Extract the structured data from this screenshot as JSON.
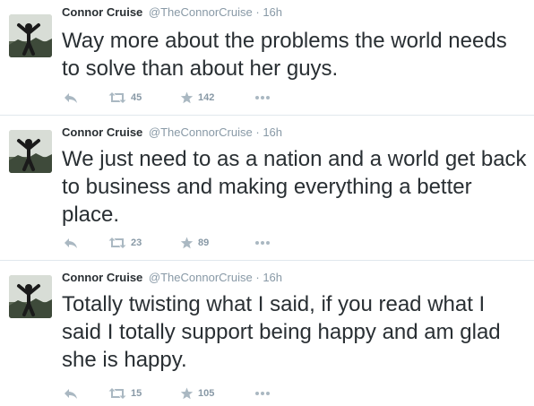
{
  "tweets": [
    {
      "name": "Connor Cruise",
      "handle": "@TheConnorCruise",
      "separator": "·",
      "time": "16h",
      "text": "Way more about the problems the world needs to solve than about her guys.",
      "retweets": "45",
      "favorites": "142"
    },
    {
      "name": "Connor Cruise",
      "handle": "@TheConnorCruise",
      "separator": "·",
      "time": "16h",
      "text": "We just need to as a nation and a world get back to business and making everything a better place.",
      "retweets": "23",
      "favorites": "89"
    },
    {
      "name": "Connor Cruise",
      "handle": "@TheConnorCruise",
      "separator": "·",
      "time": "16h",
      "text": "Totally twisting what I said, if you read what I said I totally support being happy and am glad she is happy.",
      "retweets": "15",
      "favorites": "105"
    }
  ],
  "icons": {
    "reply": "reply-icon",
    "retweet": "retweet-icon",
    "favorite": "star-icon",
    "more": "more-icon"
  },
  "colors": {
    "text": "#292f33",
    "muted": "#8899a6",
    "action_icon": "#aab8c2",
    "divider": "#e1e8ed"
  }
}
